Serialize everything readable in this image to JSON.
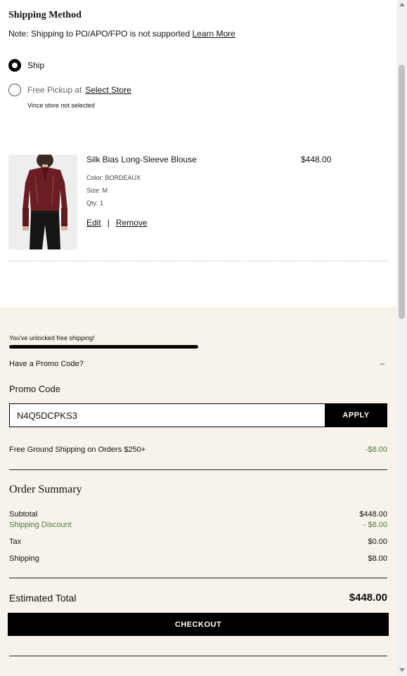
{
  "shipping": {
    "title": "Shipping Method",
    "note": "Note: Shipping to PO/APO/FPO is not supported",
    "learn_more": "Learn More",
    "option_ship": "Ship",
    "option_pickup": "Free Pickup at",
    "select_store": "Select Store",
    "store_note": "Vince store not selected"
  },
  "product": {
    "name": "Silk Bias Long-Sleeve Blouse",
    "price": "$448.00",
    "color": "Color: BORDEAUX",
    "size": "Size: M",
    "qty": "Qty: 1",
    "edit": "Edit",
    "separator": "|",
    "remove": "Remove"
  },
  "free_shipping": {
    "message": "You've unlocked free shipping!",
    "progress": 1.0
  },
  "promo": {
    "toggle_label": "Have a Promo Code?",
    "toggle_icon": "–",
    "label": "Promo Code",
    "value": "N4Q5DCPKS3",
    "apply": "APPLY",
    "applied_name": "Free Ground Shipping on Orders $250+",
    "applied_amount": "-$8.00"
  },
  "summary": {
    "title": "Order Summary",
    "subtotal_label": "Subtotal",
    "subtotal_value": "$448.00",
    "discount_label": "Shipping Discount",
    "discount_value": "- $8.00",
    "tax_label": "Tax",
    "tax_value": "$0.00",
    "shipping_label": "Shipping",
    "shipping_value": "$8.00",
    "estimated_label": "Estimated Total",
    "estimated_value": "$448.00",
    "checkout": "CHECKOUT"
  },
  "colors": {
    "panel_bg": "#f8f3ea",
    "discount_green": "#4a7a3a",
    "primary": "#000000"
  }
}
